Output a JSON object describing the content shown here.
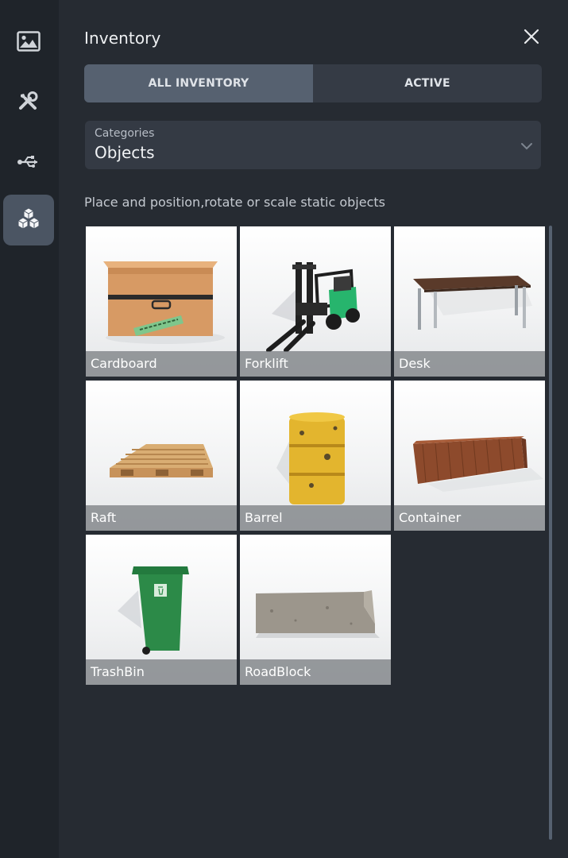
{
  "sidebar": {
    "items": [
      {
        "icon": "image-icon",
        "active": false
      },
      {
        "icon": "tools-icon",
        "active": false
      },
      {
        "icon": "usb-icon",
        "active": false
      },
      {
        "icon": "cubes-icon",
        "active": true
      }
    ]
  },
  "panel": {
    "title": "Inventory",
    "tabs": [
      {
        "label": "ALL INVENTORY",
        "selected": true
      },
      {
        "label": "ACTIVE",
        "selected": false
      }
    ],
    "categories": {
      "label": "Categories",
      "value": "Objects"
    },
    "description": "Place and position,rotate or scale static objects"
  },
  "items": [
    {
      "name": "Cardboard"
    },
    {
      "name": "Forklift"
    },
    {
      "name": "Desk"
    },
    {
      "name": "Raft"
    },
    {
      "name": "Barrel"
    },
    {
      "name": "Container"
    },
    {
      "name": "TrashBin"
    },
    {
      "name": "RoadBlock"
    }
  ],
  "colors": {
    "accent_tab": "#566170",
    "panel_bg": "#262b32",
    "rail_bg": "#1f242a"
  }
}
